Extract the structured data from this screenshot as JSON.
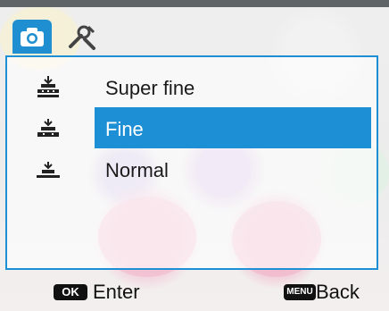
{
  "menu": {
    "tabs": [
      {
        "icon": "camera-icon",
        "active": true
      },
      {
        "icon": "tools-icon",
        "active": false
      }
    ],
    "items": [
      {
        "label": "Super fine",
        "icon": "quality-super-fine-icon",
        "selected": false
      },
      {
        "label": "Fine",
        "icon": "quality-fine-icon",
        "selected": true
      },
      {
        "label": "Normal",
        "icon": "quality-normal-icon",
        "selected": false
      }
    ],
    "accent_color": "#1d8fd4"
  },
  "footer": {
    "ok_key": "OK",
    "ok_label": "Enter",
    "menu_key": "MENU",
    "menu_label": "Back"
  }
}
